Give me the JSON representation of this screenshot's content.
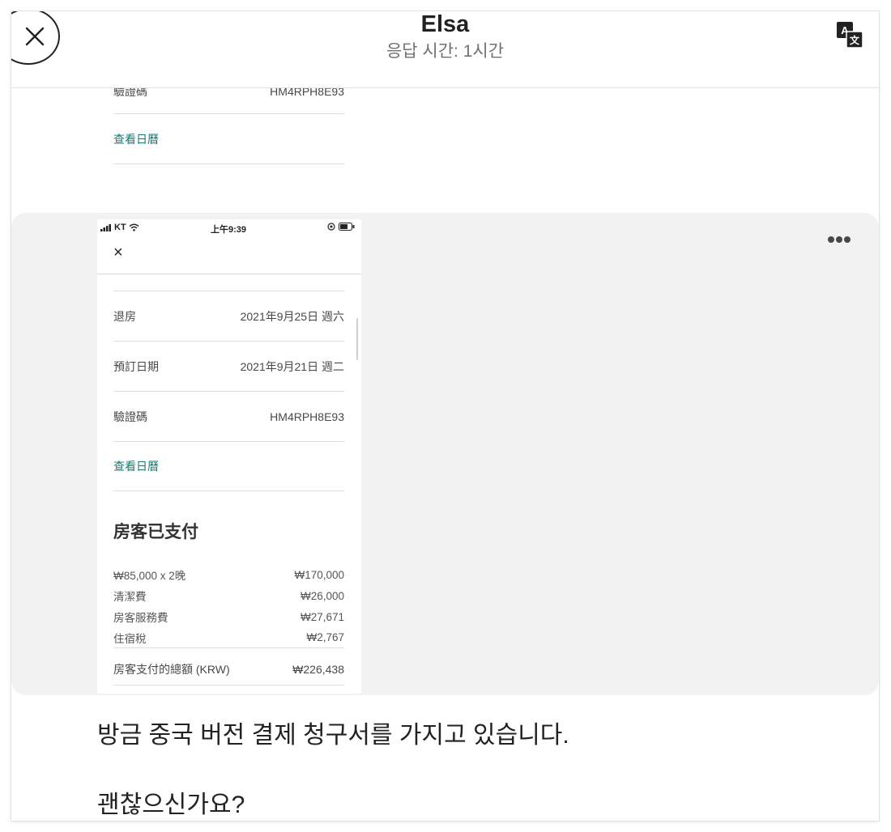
{
  "header": {
    "host_name": "Elsa",
    "response_time": "응답 시간: 1시간"
  },
  "prev_screenshot": {
    "row_label": "驗證碼",
    "row_value": "HM4RPH8E93",
    "link": "查看日曆"
  },
  "phone": {
    "status": {
      "carrier": "KT",
      "time": "上午9:39"
    },
    "rows": [
      {
        "label": "退房",
        "value": "2021年9月25日 週六"
      },
      {
        "label": "預訂日期",
        "value": "2021年9月21日 週二"
      },
      {
        "label": "驗證碼",
        "value": "HM4RPH8E93"
      }
    ],
    "link": "查看日曆",
    "paid_title": "房客已支付",
    "prices": [
      {
        "label": "₩85,000 x 2晚",
        "value": "₩170,000"
      },
      {
        "label": "清潔費",
        "value": "₩26,000"
      },
      {
        "label": "房客服務費",
        "value": "₩27,671"
      },
      {
        "label": "住宿稅",
        "value": "₩2,767"
      }
    ],
    "total": {
      "label": "房客支付的總額 (KRW)",
      "value": "₩226,438"
    }
  },
  "message": {
    "line1": "방금 중국 버전 결제 청구서를 가지고 있습니다.",
    "line2": "괜찮으신가요?"
  },
  "colors": {
    "link": "#0a8279",
    "bubble": "#f2f2f2",
    "muted": "#717171"
  },
  "icons": {
    "close": "close-icon",
    "translate": "translate-icon",
    "more": "more-dots-icon"
  }
}
